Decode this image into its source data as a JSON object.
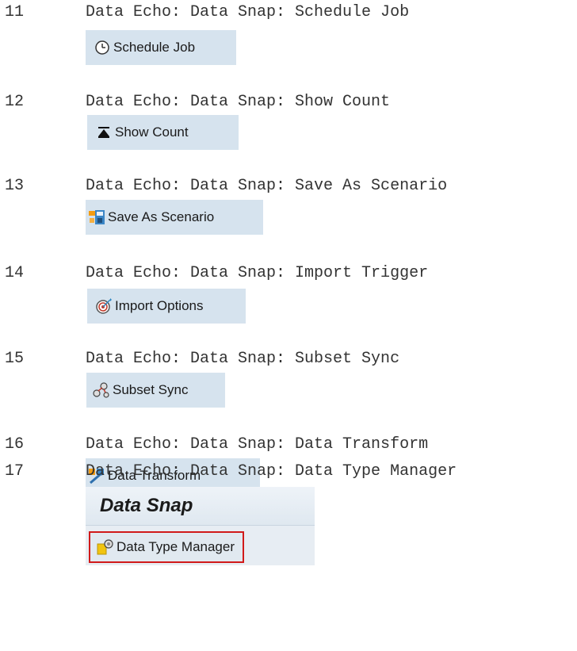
{
  "rows": [
    {
      "num": "11",
      "desc": "Data Echo: Data Snap: Schedule Job",
      "button": "Schedule Job",
      "icon": "clock-icon"
    },
    {
      "num": "12",
      "desc": "Data Echo: Data Snap: Show Count",
      "button": "Show Count",
      "icon": "count-icon"
    },
    {
      "num": "13",
      "desc": "Data Echo: Data Snap: Save As Scenario",
      "button": "Save As Scenario",
      "icon": "save-scenario-icon"
    },
    {
      "num": "14",
      "desc": "Data Echo: Data Snap: Import Trigger",
      "button": "Import Options",
      "icon": "target-icon"
    },
    {
      "num": "15",
      "desc": "Data Echo: Data Snap: Subset Sync",
      "button": "Subset Sync",
      "icon": "subset-sync-icon"
    },
    {
      "num": "16",
      "desc": "Data Echo: Data Snap: Data Transform",
      "button": "Data Transform",
      "icon": "data-transform-icon"
    },
    {
      "num": "17",
      "desc": "Data Echo: Data Snap: Data Type Manager",
      "button": "Data Type Manager",
      "icon": "data-type-manager-icon"
    }
  ],
  "snap_panel": {
    "title": "Data Snap"
  },
  "colors": {
    "button_bg": "#d6e3ee",
    "highlight_border": "#d11a1a",
    "text": "#333333"
  }
}
